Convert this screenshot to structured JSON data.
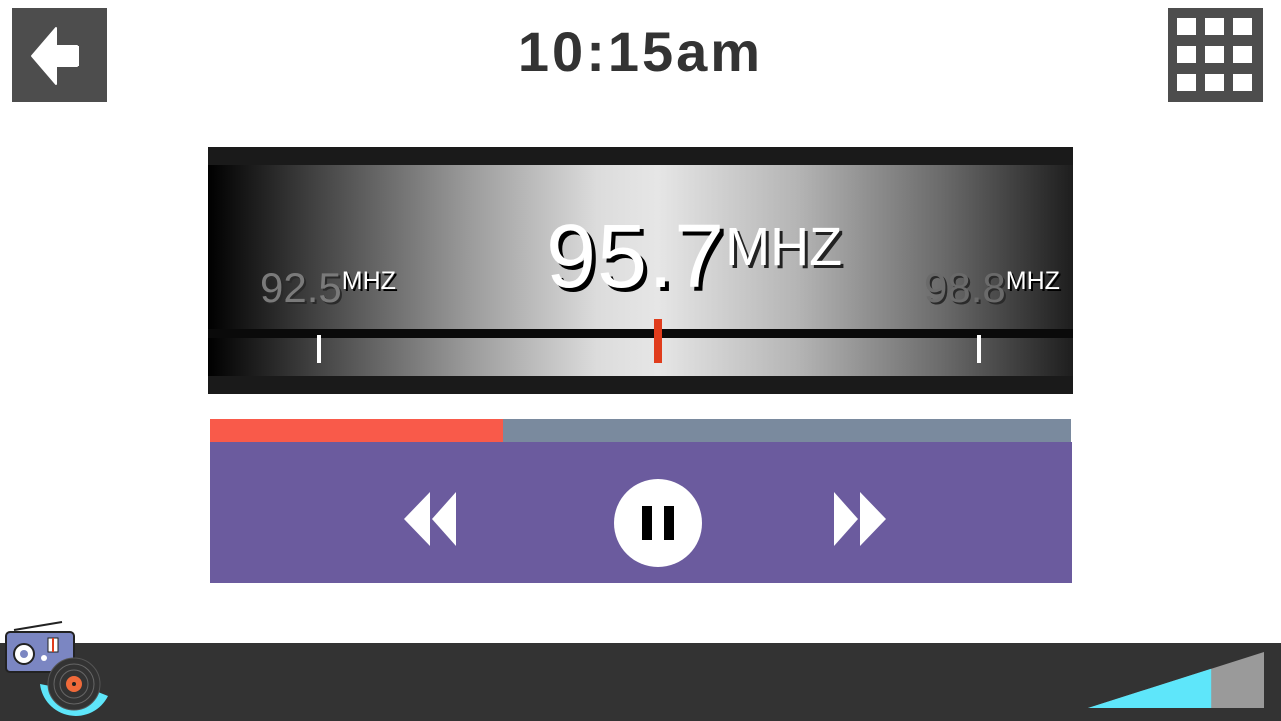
{
  "header": {
    "time": "10:15am",
    "back_icon": "back-arrow-icon",
    "menu_icon": "grid-menu-icon"
  },
  "tuner": {
    "current_frequency": "95.7",
    "current_unit": "MHZ",
    "prev_frequency": "92.5",
    "prev_unit": "MHZ",
    "next_frequency": "98.8",
    "next_unit": "MHZ",
    "needle_color": "#e03c1c"
  },
  "playback": {
    "progress": 0.34,
    "progress_color": "#f95a4a",
    "track_color": "#7a8a9e",
    "panel_color": "#6b5b9e",
    "rewind_icon": "rewind-icon",
    "pause_icon": "pause-icon",
    "fast_forward_icon": "fast-forward-icon"
  },
  "footer": {
    "app_icon": "radio-app-icon",
    "volume_icon": "volume-level-icon",
    "volume_level": 0.7,
    "volume_color": "#5ee6fa"
  }
}
